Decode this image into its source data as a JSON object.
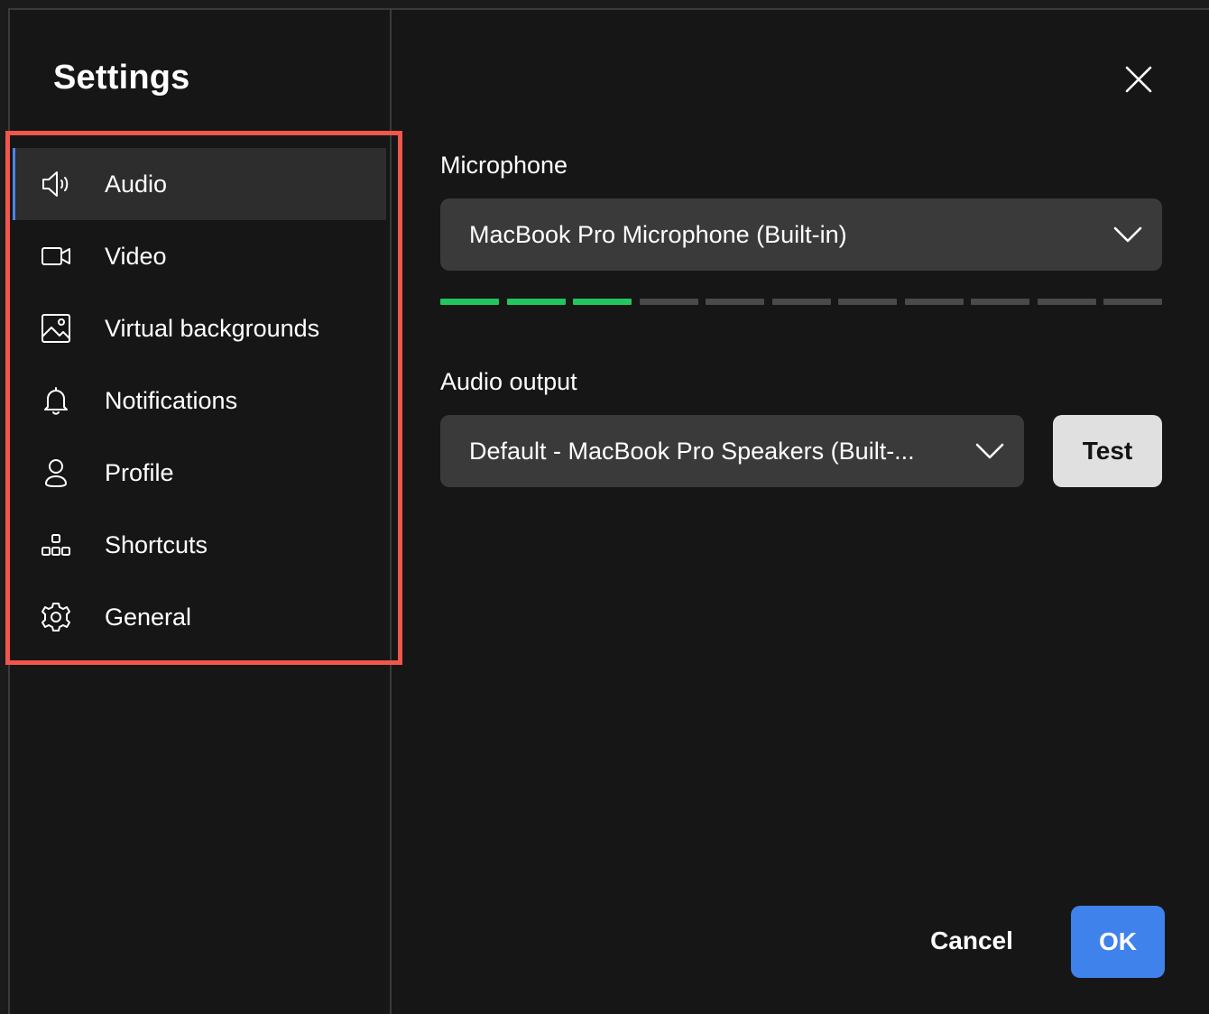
{
  "dialog": {
    "title": "Settings",
    "close_icon": "close-icon"
  },
  "sidebar": {
    "active_index": 0,
    "accent_color": "#4a84e8",
    "highlight_color": "#f0564a",
    "items": [
      {
        "label": "Audio",
        "icon": "speaker-icon"
      },
      {
        "label": "Video",
        "icon": "video-camera-icon"
      },
      {
        "label": "Virtual backgrounds",
        "icon": "image-icon"
      },
      {
        "label": "Notifications",
        "icon": "bell-icon"
      },
      {
        "label": "Profile",
        "icon": "person-icon"
      },
      {
        "label": "Shortcuts",
        "icon": "shortcuts-icon"
      },
      {
        "label": "General",
        "icon": "gear-icon"
      }
    ]
  },
  "microphone": {
    "label": "Microphone",
    "selected": "MacBook Pro Microphone (Built-in)",
    "level_segments_total": 11,
    "level_segments_active": 3,
    "level_active_color": "#22c55e",
    "level_inactive_color": "#4a4a4a"
  },
  "audio_output": {
    "label": "Audio output",
    "selected": "Default - MacBook Pro Speakers (Built-...",
    "test_label": "Test"
  },
  "footer": {
    "cancel_label": "Cancel",
    "ok_label": "OK",
    "ok_color": "#3f82ec"
  }
}
